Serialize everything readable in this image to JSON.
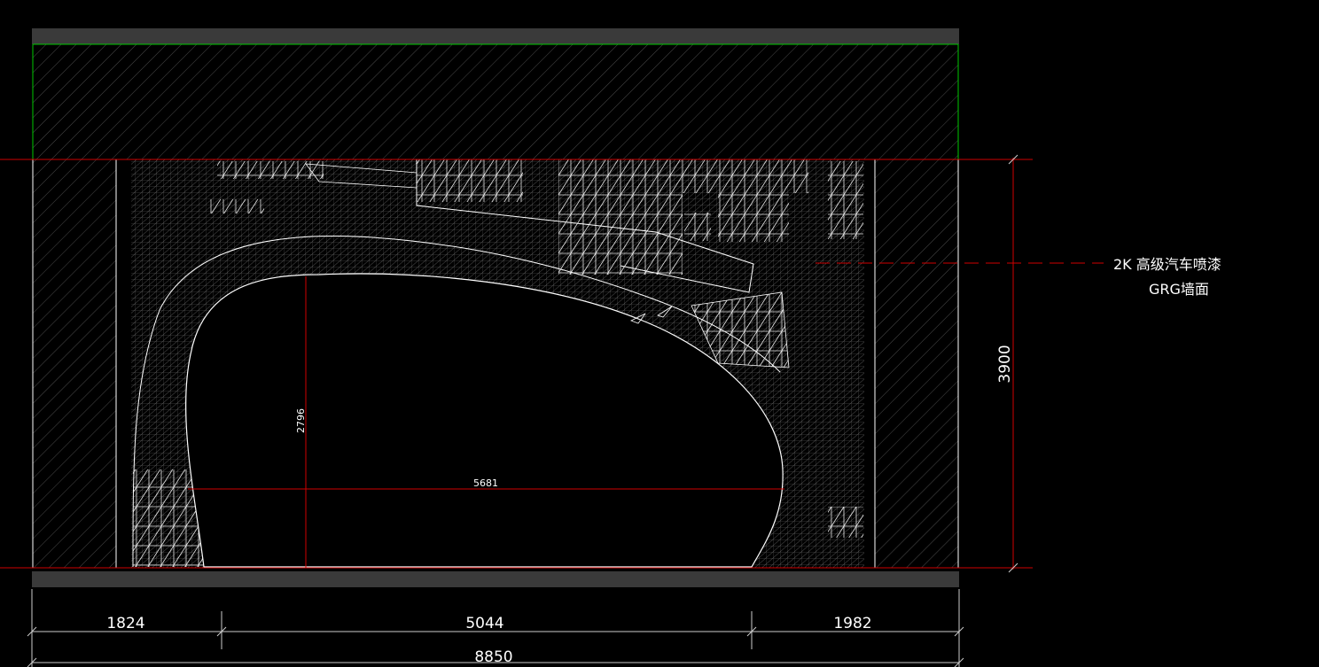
{
  "dimensions": {
    "height_right": "3900",
    "inner_height": "2796",
    "inner_width": "5681",
    "seg_left": "1824",
    "seg_mid": "5044",
    "seg_right": "1982",
    "total_width": "8850"
  },
  "annotation": {
    "line1": "2K 高级汽车喷漆",
    "line2": "GRG墙面"
  },
  "colors": {
    "background": "#000000",
    "slab": "#3a3a3a",
    "green": "#00c800",
    "red": "#d00000",
    "mesh": "#ffffff",
    "dim": "#cccccc"
  }
}
